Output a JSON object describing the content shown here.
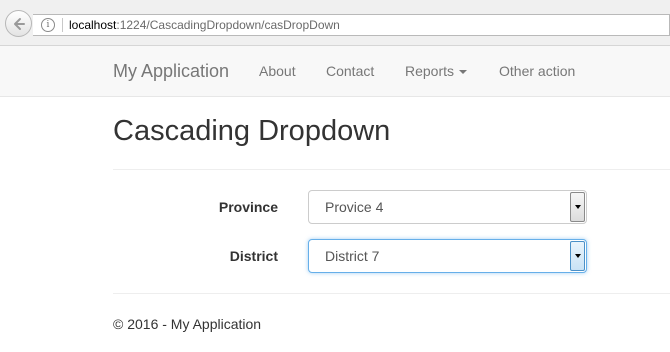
{
  "browser": {
    "url_host": "localhost",
    "url_path": ":1224/CascadingDropdown/casDropDown",
    "back_icon": "arrow-left-icon",
    "info_icon": "info-icon"
  },
  "navbar": {
    "brand": "My Application",
    "links": [
      {
        "label": "About"
      },
      {
        "label": "Contact"
      },
      {
        "label": "Reports",
        "has_caret": true
      },
      {
        "label": "Other action"
      }
    ]
  },
  "page": {
    "title": "Cascading Dropdown"
  },
  "form": {
    "province": {
      "label": "Province",
      "selected": "Provice 4"
    },
    "district": {
      "label": "District",
      "selected": "District 7"
    }
  },
  "footer": {
    "text": "© 2016 - My Application"
  },
  "colors": {
    "focus_border": "#66afe9",
    "navbar_bg": "#f8f8f8",
    "nav_text": "#777777"
  }
}
